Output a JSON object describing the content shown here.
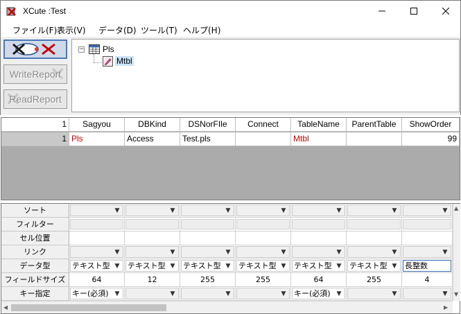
{
  "window": {
    "title": "XCute :Test"
  },
  "menu": [
    "ファイル(F)",
    "表示(V)",
    "データ(D)",
    "ツール(T)",
    "ヘルプ(H)"
  ],
  "toolbar": {
    "write_label": "WriteReport",
    "read_label": "ReadReport"
  },
  "tree": {
    "root": "Pls",
    "child": "Mtbl"
  },
  "grid": {
    "corner": "1",
    "columns": [
      "Sagyou",
      "DBKind",
      "DSNorFIle",
      "Connect",
      "TableName",
      "ParentTable",
      "ShowOrder"
    ],
    "row_number": "1",
    "row": [
      "Pls",
      "Access",
      "Test.pls",
      "",
      "Mtbl",
      "",
      "99"
    ]
  },
  "props": {
    "labels": [
      "ソート",
      "フィルター",
      "セル位置",
      "リンク",
      "データ型",
      "フィールドサイズ",
      "キー指定"
    ],
    "datatype": [
      "テキスト型",
      "テキスト型",
      "テキスト型",
      "テキスト型",
      "テキスト型",
      "テキスト型",
      "長整数"
    ],
    "fieldsize": [
      "64",
      "12",
      "255",
      "255",
      "64",
      "255",
      "4"
    ],
    "key": [
      "キー(必須)",
      "",
      "",
      "",
      "キー(必須)",
      "",
      ""
    ]
  },
  "icons": {
    "app": "app-icon",
    "minimize": "minimize-icon",
    "maximize": "maximize-icon",
    "close": "close-icon",
    "table": "table-icon",
    "edit": "edit-icon",
    "dropdown": "chevron-down-icon"
  },
  "colors": {
    "accent_red": "#c00000",
    "selection": "#cce4f7",
    "grid_empty": "#ababab"
  }
}
